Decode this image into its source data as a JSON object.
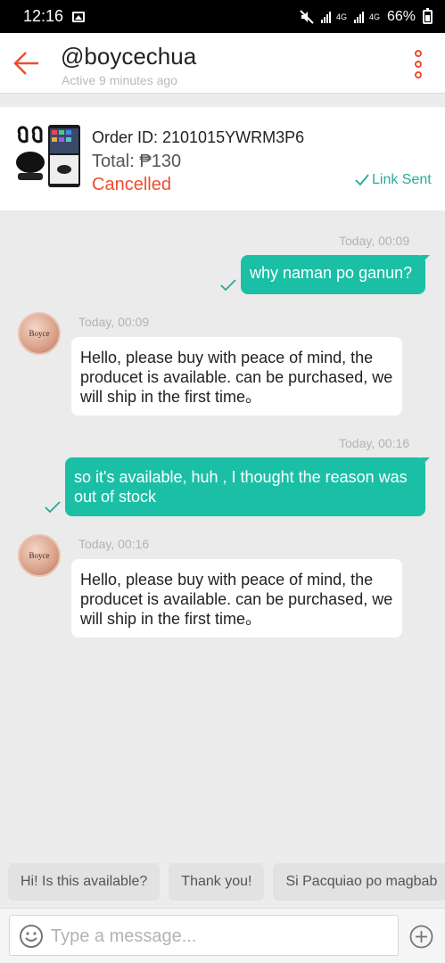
{
  "status_bar": {
    "time": "12:16",
    "network_label_1": "4G",
    "network_label_2": "4G",
    "battery": "66%"
  },
  "header": {
    "contact_name": "@boycechua",
    "active_status": "Active 9 minutes ago"
  },
  "order": {
    "id_label": "Order ID: 2101015YWRM3P6",
    "total_label": "Total: ₱130",
    "status": "Cancelled",
    "link_status": "Link Sent"
  },
  "messages": [
    {
      "direction": "sent",
      "timestamp": "Today, 00:09",
      "text": "why naman po ganun?"
    },
    {
      "direction": "received",
      "timestamp": "Today, 00:09",
      "text": "Hello, please buy with peace of mind, the producet is available. can be purchased, we will ship in the first time。"
    },
    {
      "direction": "sent",
      "timestamp": "Today, 00:16",
      "text": "so it's available, huh , I thought the reason was out of stock"
    },
    {
      "direction": "received",
      "timestamp": "Today, 00:16",
      "text": "Hello, please buy with peace of mind, the producet is available. can be purchased, we will ship in the first time。"
    }
  ],
  "avatar_text": "Boyce",
  "quick_replies": [
    "Hi! Is this available?",
    "Thank you!",
    "Si Pacquiao po magbab"
  ],
  "composer": {
    "placeholder": "Type a message..."
  },
  "colors": {
    "accent": "#ee4d2d",
    "sent_bubble": "#1bbfa6",
    "teal_text": "#26aa99"
  }
}
